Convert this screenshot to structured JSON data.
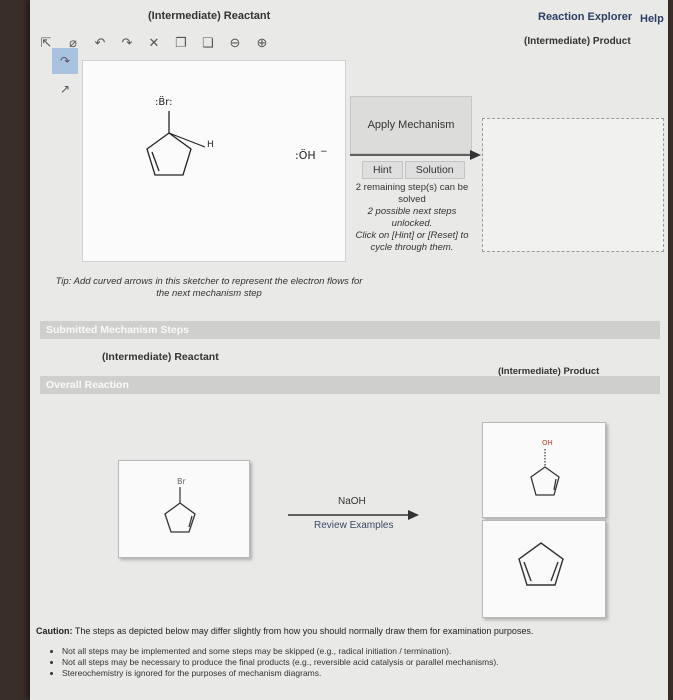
{
  "header": {
    "reactant_label": "(Intermediate) Reactant",
    "explorer_link": "Reaction Explorer",
    "help_link": "Help",
    "product_label": "(Intermediate) Product"
  },
  "toolbar": {
    "icons": [
      "select-icon",
      "eraser-icon",
      "undo-icon",
      "redo-icon",
      "clear-icon",
      "copy-icon",
      "paste-icon",
      "zoom-out-icon",
      "zoom-in-icon"
    ]
  },
  "sketch": {
    "br_label": ":B̈r:",
    "h_label": "H",
    "oh_label": ":ÖH",
    "oh_charge": "−"
  },
  "mechanism": {
    "apply_label": "Apply Mechanism",
    "hint_label": "Hint",
    "solution_label": "Solution",
    "remaining": "2 remaining step(s) can be solved",
    "possible": "2 possible next steps unlocked.",
    "cycle": "Click on [Hint] or [Reset] to cycle through them."
  },
  "tip": "Tip: Add curved arrows in this sketcher to represent the electron flows for the next mechanism step",
  "submitted": {
    "title": "Submitted Mechanism Steps",
    "reactant_label": "(Intermediate) Reactant",
    "product_label": "(Intermediate) Product"
  },
  "overall": {
    "title": "Overall Reaction",
    "reactant_br": "Br",
    "reagent": "NaOH",
    "review_link": "Review Examples",
    "product_oh": "OH"
  },
  "caution": {
    "label": "Caution:",
    "text": "The steps as depicted below may differ slightly from how you should normally draw them for examination purposes.",
    "bullets": [
      "Not all steps may be implemented and some steps may be skipped (e.g., radical initiation / termination).",
      "Not all steps may be necessary to produce the final products (e.g., reversible acid catalysis or parallel mechanisms).",
      "Stereochemistry is ignored for the purposes of mechanism diagrams."
    ]
  },
  "colors": {
    "accent": "#2a3f66",
    "section_bar": "#cfcfcd",
    "active_tool": "#a9c3de"
  }
}
